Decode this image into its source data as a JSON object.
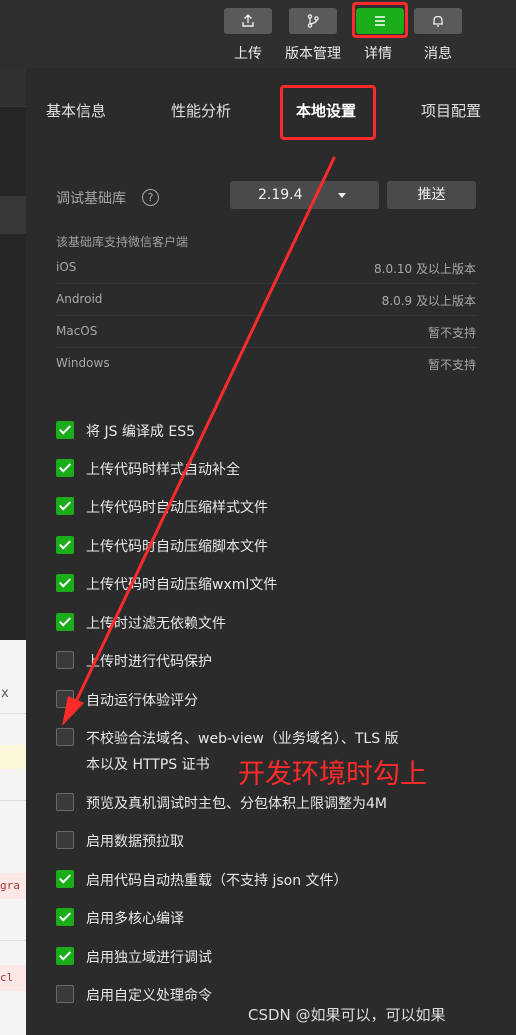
{
  "toolbar": {
    "upload_label": "上传",
    "version_label": "版本管理",
    "details_label": "详情",
    "messages_label": "消息"
  },
  "tabs": [
    "基本信息",
    "性能分析",
    "本地设置",
    "项目配置"
  ],
  "active_tab": "本地设置",
  "debug_lib": {
    "label": "调试基础库",
    "help": "?",
    "version": "2.19.4",
    "push_label": "推送",
    "support_note": "该基础库支持微信客户端",
    "platforms": [
      {
        "name": "iOS",
        "value": "8.0.10 及以上版本"
      },
      {
        "name": "Android",
        "value": "8.0.9 及以上版本"
      },
      {
        "name": "MacOS",
        "value": "暂不支持"
      },
      {
        "name": "Windows",
        "value": "暂不支持"
      }
    ]
  },
  "options": [
    {
      "label": "将 JS 编译成 ES5",
      "checked": true
    },
    {
      "label": "上传代码时样式自动补全",
      "checked": true
    },
    {
      "label": "上传代码时自动压缩样式文件",
      "checked": true
    },
    {
      "label": "上传代码时自动压缩脚本文件",
      "checked": true
    },
    {
      "label": "上传代码时自动压缩wxml文件",
      "checked": true
    },
    {
      "label": "上传时过滤无依赖文件",
      "checked": true
    },
    {
      "label": "上传时进行代码保护",
      "checked": false
    },
    {
      "label": "自动运行体验评分",
      "checked": false
    },
    {
      "label": "不校验合法域名、web-view（业务域名）、TLS 版",
      "label2": "本以及 HTTPS 证书",
      "checked": false
    },
    {
      "label": "预览及真机调试时主包、分包体积上限调整为4M",
      "checked": false
    },
    {
      "label": "启用数据预拉取",
      "checked": false
    },
    {
      "label": "启用代码自动热重载（不支持 json 文件）",
      "checked": true
    },
    {
      "label": "启用多核心编译",
      "checked": true
    },
    {
      "label": "启用独立域进行调试",
      "checked": true
    },
    {
      "label": "启用自定义处理命令",
      "checked": false
    }
  ],
  "annotation": "开发环境时勾上",
  "watermark": "CSDN @如果可以，可以如果",
  "left_strip": {
    "x_label": "x",
    "code_a": "gra",
    "code_b": "cl"
  },
  "colors": {
    "accent": "#1aad19",
    "annotation": "#ff2a2a"
  }
}
